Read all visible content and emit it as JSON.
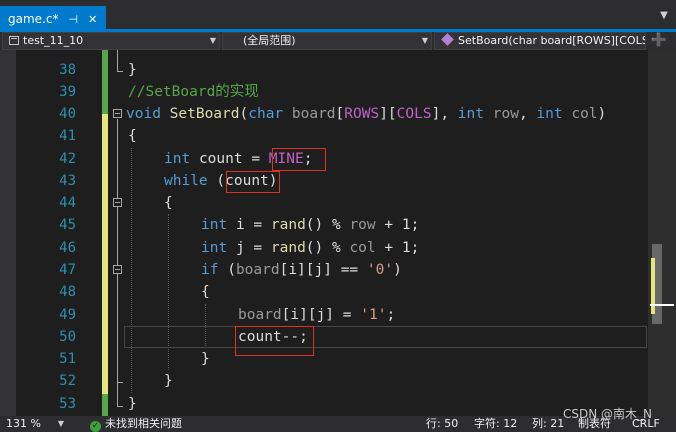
{
  "tab": {
    "title": "game.c*",
    "pin": "⊣",
    "close": "✕"
  },
  "navbar": {
    "project": "test_11_10",
    "scope": "(全局范围)",
    "member": "SetBoard(char board[ROWS][COLS], int row, int col)",
    "split": "➕"
  },
  "editor": {
    "line_numbers": [
      "38",
      "39",
      "40",
      "41",
      "42",
      "43",
      "44",
      "45",
      "46",
      "47",
      "48",
      "49",
      "50",
      "51",
      "52",
      "53"
    ],
    "lines": {
      "l38": "}",
      "l39": "//SetBoard的实现",
      "l40_kw1": "void",
      "l40_fn": "SetBoard",
      "l40_p1": "(",
      "l40_kw2": "char",
      "l40_param1": "board",
      "l40_b1": "[",
      "l40_macro1": "ROWS",
      "l40_b2": "][",
      "l40_macro2": "COLS",
      "l40_b3": "], ",
      "l40_kw3": "int",
      "l40_param2": "row",
      "l40_c2": ", ",
      "l40_kw4": "int",
      "l40_param3": "col",
      "l40_p2": ")",
      "l41": "{",
      "l42_kw": "int",
      "l42_var": "count",
      "l42_op": " = ",
      "l42_macro": "MINE",
      "l42_end": ";",
      "l43_kw": "while",
      "l43_p1": " (",
      "l43_var": "count",
      "l43_p2": ")",
      "l44": "{",
      "l45_kw": "int",
      "l45_var": "i",
      "l45_op": " = ",
      "l45_fn": "rand",
      "l45_mid": "() % ",
      "l45_param": "row",
      "l45_end": " + 1;",
      "l46_kw": "int",
      "l46_var": "j",
      "l46_op": " = ",
      "l46_fn": "rand",
      "l46_mid": "() % ",
      "l46_param": "col",
      "l46_end": " + 1;",
      "l47_kw": "if",
      "l47_p1": " (",
      "l47_param": "board",
      "l47_idx": "[i][j] == ",
      "l47_str": "'0'",
      "l47_p2": ")",
      "l48": "{",
      "l49_param": "board",
      "l49_idx": "[i][j] = ",
      "l49_str": "'1'",
      "l49_end": ";",
      "l50": "count--;",
      "l51": "}",
      "l52": "}",
      "l53": "}"
    }
  },
  "status": {
    "zoom": "131 %",
    "issues": "未找到相关问题",
    "line": "行: 50",
    "char": "字符: 12",
    "col": "列: 21",
    "tabs": "制表符",
    "eol": "CRLF"
  },
  "watermark": "CSDN @南木_N"
}
